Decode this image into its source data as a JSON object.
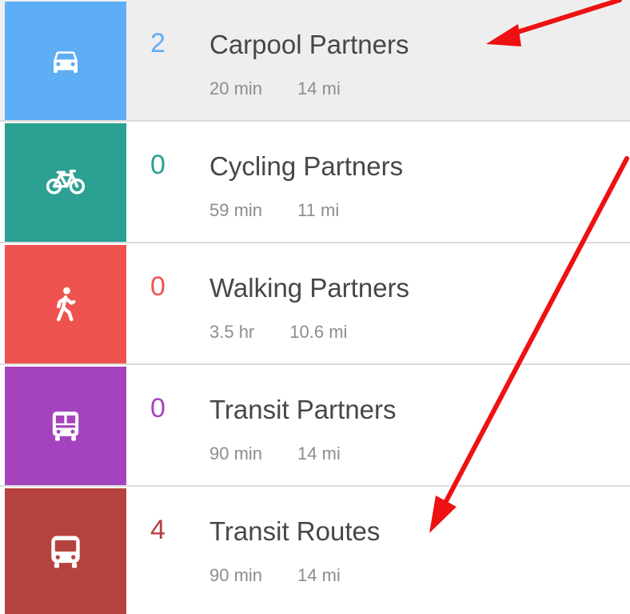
{
  "rows": [
    {
      "count": "2",
      "title": "Carpool Partners",
      "time": "20 min",
      "distance": "14 mi",
      "color": "#5eaef5",
      "icon": "car-icon",
      "selected": true
    },
    {
      "count": "0",
      "title": "Cycling Partners",
      "time": "59 min",
      "distance": "11 mi",
      "color": "#2ba093",
      "icon": "bicycle-icon",
      "selected": false
    },
    {
      "count": "0",
      "title": "Walking Partners",
      "time": "3.5 hr",
      "distance": "10.6 mi",
      "color": "#ef5350",
      "icon": "walking-person-icon",
      "selected": false
    },
    {
      "count": "0",
      "title": "Transit Partners",
      "time": "90 min",
      "distance": "14 mi",
      "color": "#a543be",
      "icon": "bus-front-icon",
      "selected": false
    },
    {
      "count": "4",
      "title": "Transit Routes",
      "time": "90 min",
      "distance": "14 mi",
      "color": "#b64240",
      "icon": "bus-icon",
      "selected": false
    }
  ],
  "annotation_color": "#ee1111"
}
